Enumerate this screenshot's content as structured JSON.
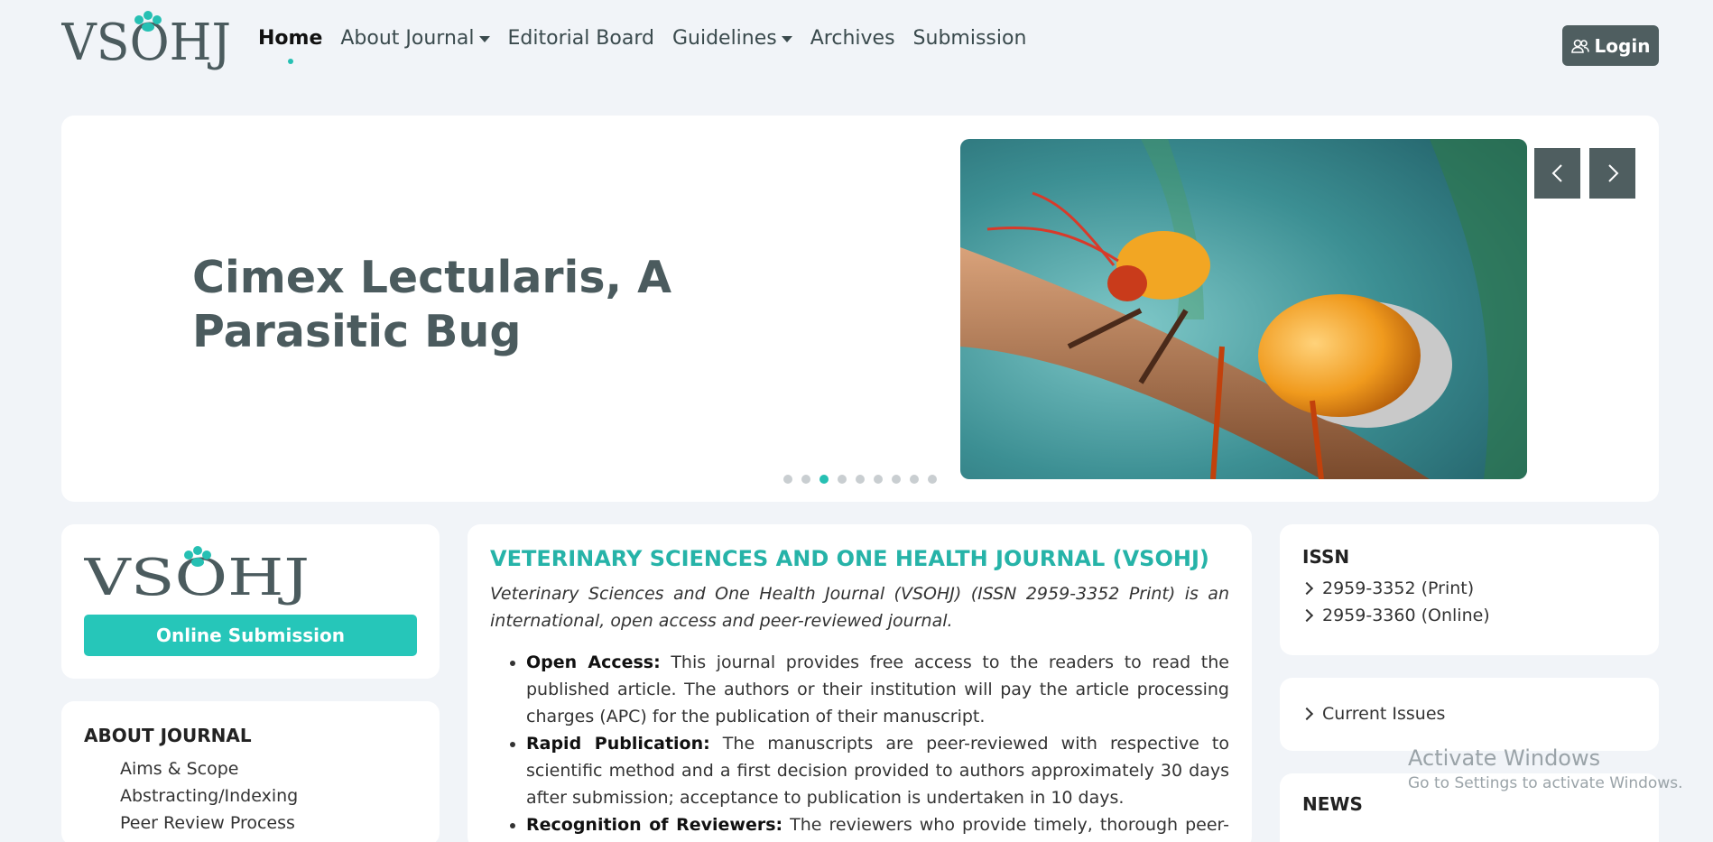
{
  "header": {
    "logo_text": "VSOHJ",
    "nav": [
      {
        "label": "Home",
        "active": true,
        "dropdown": false
      },
      {
        "label": "About Journal",
        "active": false,
        "dropdown": true
      },
      {
        "label": "Editorial Board",
        "active": false,
        "dropdown": false
      },
      {
        "label": "Guidelines",
        "active": false,
        "dropdown": true
      },
      {
        "label": "Archives",
        "active": false,
        "dropdown": false
      },
      {
        "label": "Submission",
        "active": false,
        "dropdown": false
      }
    ],
    "login_label": "Login"
  },
  "hero": {
    "title": "Cimex Lectularis, A Parasitic Bug",
    "slide_count": 9,
    "active_slide": 3
  },
  "left": {
    "online_submission_label": "Online Submission",
    "about_heading": "ABOUT JOURNAL",
    "links": [
      "Aims & Scope",
      "Abstracting/Indexing",
      "Peer Review Process"
    ]
  },
  "main": {
    "title": "VETERINARY SCIENCES AND ONE HEALTH JOURNAL (VSOHJ)",
    "intro": "Veterinary Sciences and One Health Journal (VSOHJ) (ISSN 2959-3352 Print) is an international, open access and peer-reviewed journal.",
    "bullets": [
      {
        "term": "Open Access:",
        "text": " This journal provides free access to the readers to read the published article. The authors or their institution will pay the article processing charges (APC) for the publication of their manuscript."
      },
      {
        "term": "Rapid Publication:",
        "text": " The manuscripts are peer-reviewed with respective to scientific method and a first decision provided to authors approximately 30 days after submission; acceptance to publication is undertaken in 10 days."
      },
      {
        "term": "Recognition of Reviewers:",
        "text": " The reviewers who provide timely, thorough peer-review"
      }
    ]
  },
  "right": {
    "issn_heading": "ISSN",
    "issn_items": [
      "2959-3352 (Print)",
      "2959-3360 (Online)"
    ],
    "current_issues_label": "Current Issues",
    "news_heading": "NEWS"
  },
  "watermark": {
    "line1": "Activate Windows",
    "line2": "Go to Settings to activate Windows."
  },
  "colors": {
    "accent": "#26c0b3",
    "dark": "#4f5e60",
    "background": "#f1f4f8"
  }
}
